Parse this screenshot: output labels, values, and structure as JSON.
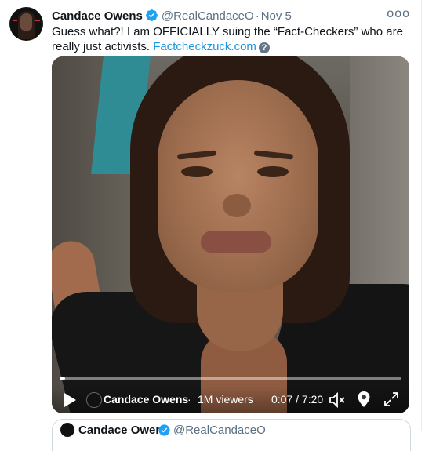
{
  "tweet": {
    "author_name": "Candace Owens",
    "handle": "@RealCandaceO",
    "separator": "·",
    "date": "Nov 5",
    "more_label": "ooo",
    "text": "Guess what?! I am OFFICIALLY suing the “Fact-Checkers” who are really just activists.",
    "link_text": "Factcheckzuck.com",
    "link_help_label": "?"
  },
  "video": {
    "channel_name": "Candace Owens",
    "separator": "·",
    "viewers": "1M viewers",
    "time": "0:07 / 7:20",
    "progress": 0.016
  },
  "quoted_tweet": {
    "author_name": "Candace Owens",
    "handle": "@RealCandaceO"
  },
  "colors": {
    "link": "#1b95e0",
    "verified": "#1da1f2",
    "secondary_text": "#5b7083"
  }
}
